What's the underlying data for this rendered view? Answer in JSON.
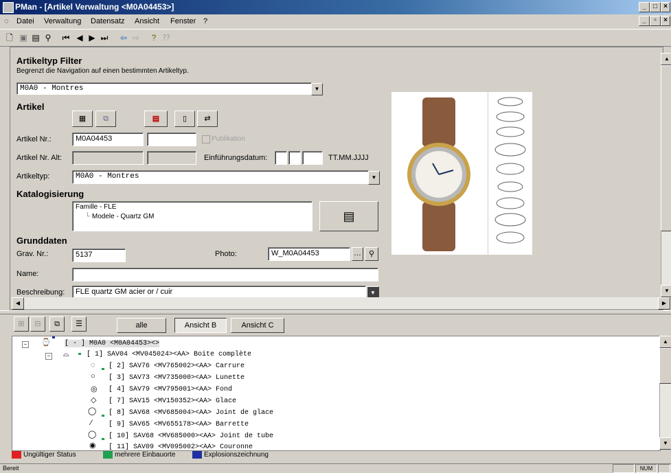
{
  "window": {
    "title": "PMan - [Artikel Verwaltung <M0A04453>]"
  },
  "menu": [
    "Datei",
    "Verwaltung",
    "Datensatz",
    "Ansicht",
    "Fenster",
    "?"
  ],
  "filter": {
    "heading": "Artikeltyp Filter",
    "description": "Begrenzt die Navigation auf einen bestimmten Artikeltyp.",
    "selected": "M0A0  - Montres"
  },
  "artikel": {
    "heading": "Artikel",
    "nr_label": "Artikel Nr.:",
    "nr_value": "M0A04453",
    "publikation_label": "Publikation",
    "nr_alt_label": "Artikel Nr. Alt:",
    "einfuehrung_label": "Einführungsdatum:",
    "date_format": "TT.MM.JJJJ",
    "typ_label": "Artikeltyp:",
    "typ_value": "M0A0  - Montres"
  },
  "katalog": {
    "heading": "Katalogisierung",
    "items": [
      "Famille - FLE",
      "Modele - Quartz GM"
    ]
  },
  "grunddaten": {
    "heading": "Grunddaten",
    "grav_label": "Grav. Nr.:",
    "grav_value": "5137",
    "photo_label": "Photo:",
    "photo_value": "W_M0A04453",
    "name_label": "Name:",
    "name_value": "",
    "beschreibung_label": "Beschreibung:",
    "beschreibung_value": "FLE quartz GM acier or / cuir"
  },
  "tabs": [
    "alle",
    "Ansicht B",
    "Ansicht C"
  ],
  "tree": [
    "[ - ] M0A0 <M0A04453><>",
    "[  1] SAV04 <MV045024><AA> Boite complète",
    "[  2] SAV76 <MV765002><AA> Carrure",
    "[  3] SAV73 <MV735000><AA> Lunette",
    "[  4] SAV79 <MV795001><AA> Fond",
    "[  7] SAV15 <MV150352><AA> Glace",
    "[  8] SAV68 <MV685004><AA> Joint de glace",
    "[  9] SAV65 <MV655178><AA> Barrette",
    "[ 10] SAV68 <MV685000><AA> Joint de tube",
    "[ 11] SAV09 <MV095002><AA> Couronne"
  ],
  "legend": [
    {
      "label": "Ungültiger Status",
      "color": "#e02020"
    },
    {
      "label": "mehrere Einbauorte",
      "color": "#20a050"
    },
    {
      "label": "Explosionszeichnung",
      "color": "#2030a0"
    }
  ],
  "status": {
    "left": "Bereit",
    "num": "NUM"
  }
}
